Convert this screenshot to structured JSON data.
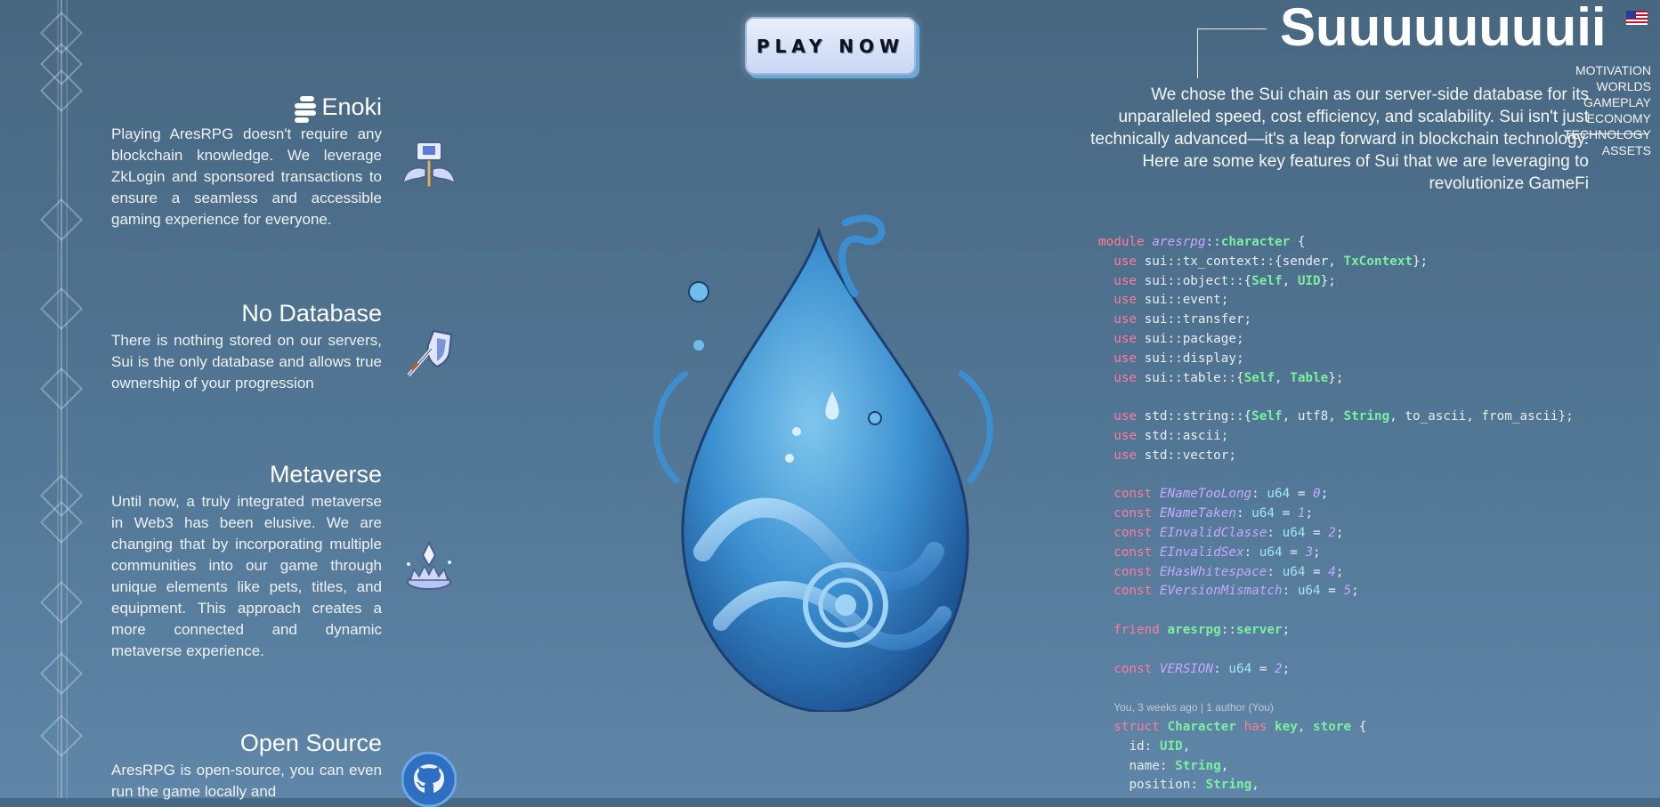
{
  "play_button": {
    "label": "PLAY NOW"
  },
  "header": {
    "title": "Suuuuuuuuii",
    "language_flag": "us-flag"
  },
  "nav": {
    "items": [
      {
        "label": "MOTIVATION"
      },
      {
        "label": "WORLDS"
      },
      {
        "label": "GAMEPLAY"
      },
      {
        "label": "ECONOMY"
      },
      {
        "label": "TECHNOLOGY",
        "active": true
      },
      {
        "label": "ASSETS"
      }
    ]
  },
  "intro": "We chose the Sui chain as our server-side database for its unparalleled speed, cost efficiency, and scalability. Sui isn't just technically advanced—it's a leap forward in blockchain technology. Here are some key features of Sui that we are leveraging to revolutionize GameFi",
  "features": [
    {
      "title": "Enoki",
      "body": "Playing AresRPG doesn't require any blockchain knowledge. We leverage ZkLogin and sponsored transactions to ensure a seamless and accessible gaming experience for everyone.",
      "icon": "hammer-wings-icon"
    },
    {
      "title": "No Database",
      "body": "There is nothing stored on our servers, Sui is the only database and allows true ownership of your progression",
      "icon": "sword-shield-icon"
    },
    {
      "title": "Metaverse",
      "body": "Until now, a truly integrated metaverse in Web3 has been elusive. We are changing that by incorporating multiple communities into our game through unique elements like pets, titles, and equipment. This approach creates a more connected and dynamic metaverse experience.",
      "icon": "crystal-crown-icon"
    },
    {
      "title": "Open Source",
      "body": "AresRPG is open-source, you can even run the game locally and",
      "icon": "github-icon"
    }
  ],
  "code": {
    "module_kw": "module",
    "module_pkg": "aresrpg",
    "module_name": "character",
    "uses": [
      {
        "path": "sui::tx_context::{",
        "a": "sender",
        "b": "TxContext",
        "end": "};"
      },
      {
        "path": "sui::object::{",
        "a": "Self",
        "b": "UID",
        "end": "};"
      },
      {
        "path": "sui::event;"
      },
      {
        "path": "sui::transfer;"
      },
      {
        "path": "sui::package;"
      },
      {
        "path": "sui::display;"
      },
      {
        "path": "sui::table::{",
        "a": "Self",
        "b": "Table",
        "end": "};"
      }
    ],
    "std_string": "std::string::{",
    "std_string_rest": ", utf8, ",
    "std_string_rest2": ", to_ascii, from_ascii};",
    "std_ascii": "std::ascii;",
    "std_vector": "std::vector;",
    "consts": [
      {
        "name": "ENameTooLong",
        "val": "0"
      },
      {
        "name": "ENameTaken",
        "val": "1"
      },
      {
        "name": "EInvalidClasse",
        "val": "2"
      },
      {
        "name": "EInvalidSex",
        "val": "3"
      },
      {
        "name": "EHasWhitespace",
        "val": "4"
      },
      {
        "name": "EVersionMismatch",
        "val": "5"
      }
    ],
    "friend": "aresrpg::server;",
    "version_name": "VERSION",
    "version_val": "2",
    "blame": "You, 3 weeks ago | 1 author (You)",
    "struct_name": "Character",
    "fields": [
      {
        "name": "id",
        "type": "UID"
      },
      {
        "name": "name",
        "type": "String"
      },
      {
        "name": "position",
        "type": "String"
      }
    ]
  },
  "colors": {
    "keyword": "#ff7b9c",
    "type": "#7cf0a0",
    "constant": "#c7a8ff",
    "background_top": "#486781",
    "background_bottom": "#5f86a8"
  }
}
